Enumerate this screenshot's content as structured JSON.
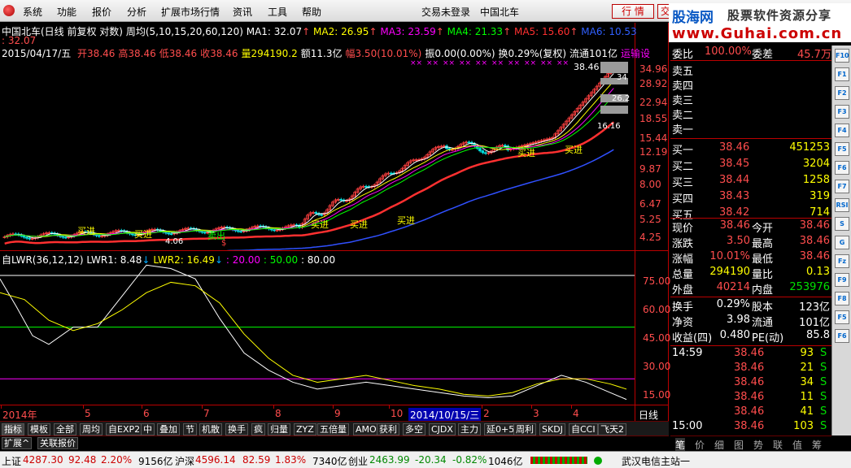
{
  "menubar": {
    "items": [
      "系统",
      "功能",
      "报价",
      "分析",
      "扩展市场行情",
      "资讯",
      "工具",
      "帮助"
    ],
    "trade_status": "交易未登录",
    "stock_name": "中国北车",
    "button1": "行 情",
    "button2": "交"
  },
  "brand": {
    "line1": "股海网",
    "line2": "股票软件资源分享",
    "line3": "www.Guhai.com.cn"
  },
  "chart_header": {
    "title": "中国北车(日线 前复权 对数)",
    "cycle": "周均(5,10,15,20,60,120)",
    "ma1": "MA1: 32.07",
    "ma2": "MA2: 26.95",
    "ma3": "MA3: 23.59",
    "ma4": "MA4: 21.33",
    "ma5": "MA5: 15.60",
    "ma6": "MA6: 10.53",
    "ma_colors": [
      "#ffffff",
      "#ffff00",
      "#ff00ff",
      "#00ff00",
      "#ff3030",
      "#3060ff"
    ],
    "extra": ": 32.07",
    "date": "2015/04/17/五",
    "info_parts": [
      {
        "t": "开38.46",
        "c": "#ff4d4d"
      },
      {
        "t": "高38.46",
        "c": "#ff4d4d"
      },
      {
        "t": "低38.46",
        "c": "#ff4d4d"
      },
      {
        "t": "收38.46",
        "c": "#ff4d4d"
      },
      {
        "t": "量294190.2",
        "c": "#ffff00"
      },
      {
        "t": "额11.3亿",
        "c": "#ffffff"
      },
      {
        "t": "幅3.50(10.01%)",
        "c": "#ff4d4d"
      },
      {
        "t": "振0.00(0.00%)",
        "c": "#ffffff"
      },
      {
        "t": "换0.29%(复权)",
        "c": "#ffffff"
      },
      {
        "t": "流通101亿",
        "c": "#ffffff"
      },
      {
        "t": "运输设",
        "c": "#ff00ff"
      }
    ]
  },
  "price_axis": [
    "34.96",
    "28.92",
    "22.94",
    "18.55",
    "15.44",
    "12.19",
    "9.87",
    "8.00",
    "6.47",
    "5.25",
    "4.25"
  ],
  "chart_labels": {
    "peak_price": "38.46",
    "low_price": "4.06",
    "buy_label": "买进",
    "sell_label": "卖出",
    "dollar": "$",
    "tag34": "34",
    "tag26": "26.2",
    "tag16": "16.16"
  },
  "indicator_header": {
    "name": "自LWR(36,12,12)",
    "lwr1": "LWR1: 8.48",
    "lwr2": "LWR2: 16.49",
    "l20": ": 20.00",
    "l50": ": 50.00",
    "l80": ": 80.00"
  },
  "indicator_axis": [
    "75.00",
    "60.00",
    "45.00",
    "30.00",
    "15.00"
  ],
  "date_axis": {
    "labels": [
      "2014年",
      "5",
      "6",
      "7",
      "8",
      "9",
      "10",
      "2",
      "3",
      "4"
    ],
    "cursor": "2014/10/15/三",
    "period": "日线"
  },
  "tabs": [
    "指标",
    "模板",
    "全部",
    "周均",
    "自EXP2",
    "中",
    "叠加",
    "节",
    "机散",
    "换手",
    "疯",
    "归量",
    "ZYZ",
    "五倍量",
    "AMO",
    "获利",
    "多空",
    "CJDX",
    "主力",
    "延0+5",
    "周利",
    "SKDJ",
    "自CCI",
    "飞天2"
  ],
  "subtabs": [
    "扩展^",
    "关联报价"
  ],
  "quote": {
    "weibi_label": "委比",
    "weibi_value": "100.00%",
    "weicha_label": "委差",
    "weicha_value": "45.7万",
    "sell": [
      {
        "label": "卖五",
        "price": "",
        "vol": ""
      },
      {
        "label": "卖四",
        "price": "",
        "vol": ""
      },
      {
        "label": "卖三",
        "price": "",
        "vol": ""
      },
      {
        "label": "卖二",
        "price": "",
        "vol": ""
      },
      {
        "label": "卖一",
        "price": "",
        "vol": ""
      }
    ],
    "buy": [
      {
        "label": "买一",
        "price": "38.46",
        "vol": "451253"
      },
      {
        "label": "买二",
        "price": "38.45",
        "vol": "3204"
      },
      {
        "label": "买三",
        "price": "38.44",
        "vol": "1258"
      },
      {
        "label": "买四",
        "price": "38.43",
        "vol": "319"
      },
      {
        "label": "买五",
        "price": "38.42",
        "vol": "714"
      }
    ],
    "stats": [
      {
        "l1": "现价",
        "v1": "38.46",
        "l2": "今开",
        "v2": "38.46",
        "c1": "#ff4d4d",
        "c2": "#ff4d4d"
      },
      {
        "l1": "涨跌",
        "v1": "3.50",
        "l2": "最高",
        "v2": "38.46",
        "c1": "#ff4d4d",
        "c2": "#ff4d4d"
      },
      {
        "l1": "涨幅",
        "v1": "10.01%",
        "l2": "最低",
        "v2": "38.46",
        "c1": "#ff4d4d",
        "c2": "#ff4d4d"
      },
      {
        "l1": "总量",
        "v1": "294190",
        "l2": "量比",
        "v2": "0.13",
        "c1": "#ffff00",
        "c2": "#ffff00"
      },
      {
        "l1": "外盘",
        "v1": "40214",
        "l2": "内盘",
        "v2": "253976",
        "c1": "#ff4d4d",
        "c2": "#00e000"
      }
    ],
    "stats2": [
      {
        "l1": "换手",
        "v1": "0.29%",
        "l2": "股本",
        "v2": "123亿"
      },
      {
        "l1": "净资",
        "v1": "3.98",
        "l2": "流通",
        "v2": "101亿"
      },
      {
        "l1": "收益(四)",
        "v1": "0.480",
        "l2": "PE(动)",
        "v2": "85.8"
      }
    ],
    "ticks": [
      {
        "time": "14:59",
        "price": "38.46",
        "vol": "93",
        "side": "S"
      },
      {
        "time": "",
        "price": "38.46",
        "vol": "21",
        "side": "S"
      },
      {
        "time": "",
        "price": "38.46",
        "vol": "34",
        "side": "S"
      },
      {
        "time": "",
        "price": "38.46",
        "vol": "11",
        "side": "S"
      },
      {
        "time": "",
        "price": "38.46",
        "vol": "41",
        "side": "S"
      },
      {
        "time": "15:00",
        "price": "38.46",
        "vol": "103",
        "side": "S"
      }
    ],
    "bottom_tabs": [
      "笔",
      "价",
      "细",
      "图",
      "势",
      "联",
      "值",
      "筹"
    ]
  },
  "toolbar_icons": [
    "F10",
    "F1",
    "F2",
    "F3",
    "F4",
    "F5",
    "F6",
    "F7",
    "RSI",
    "S",
    "G",
    "Fz",
    "F9",
    "F8",
    "F5",
    "F6"
  ],
  "status": {
    "sh_label": "上证",
    "sh_value": "4287.30",
    "sh_chg": "92.48",
    "sh_pct": "2.20%",
    "sh_amt": "9156亿",
    "hs_label": "沪深",
    "hs_value": "4596.14",
    "hs_chg": "82.59",
    "hs_pct": "1.83%",
    "hs_amt": "7340亿",
    "cy_label": "创业",
    "cy_value": "2463.99",
    "cy_chg": "-20.34",
    "cy_pct": "-0.82%",
    "cy_amt": "1046亿",
    "server": "武汉电信主站一"
  }
}
